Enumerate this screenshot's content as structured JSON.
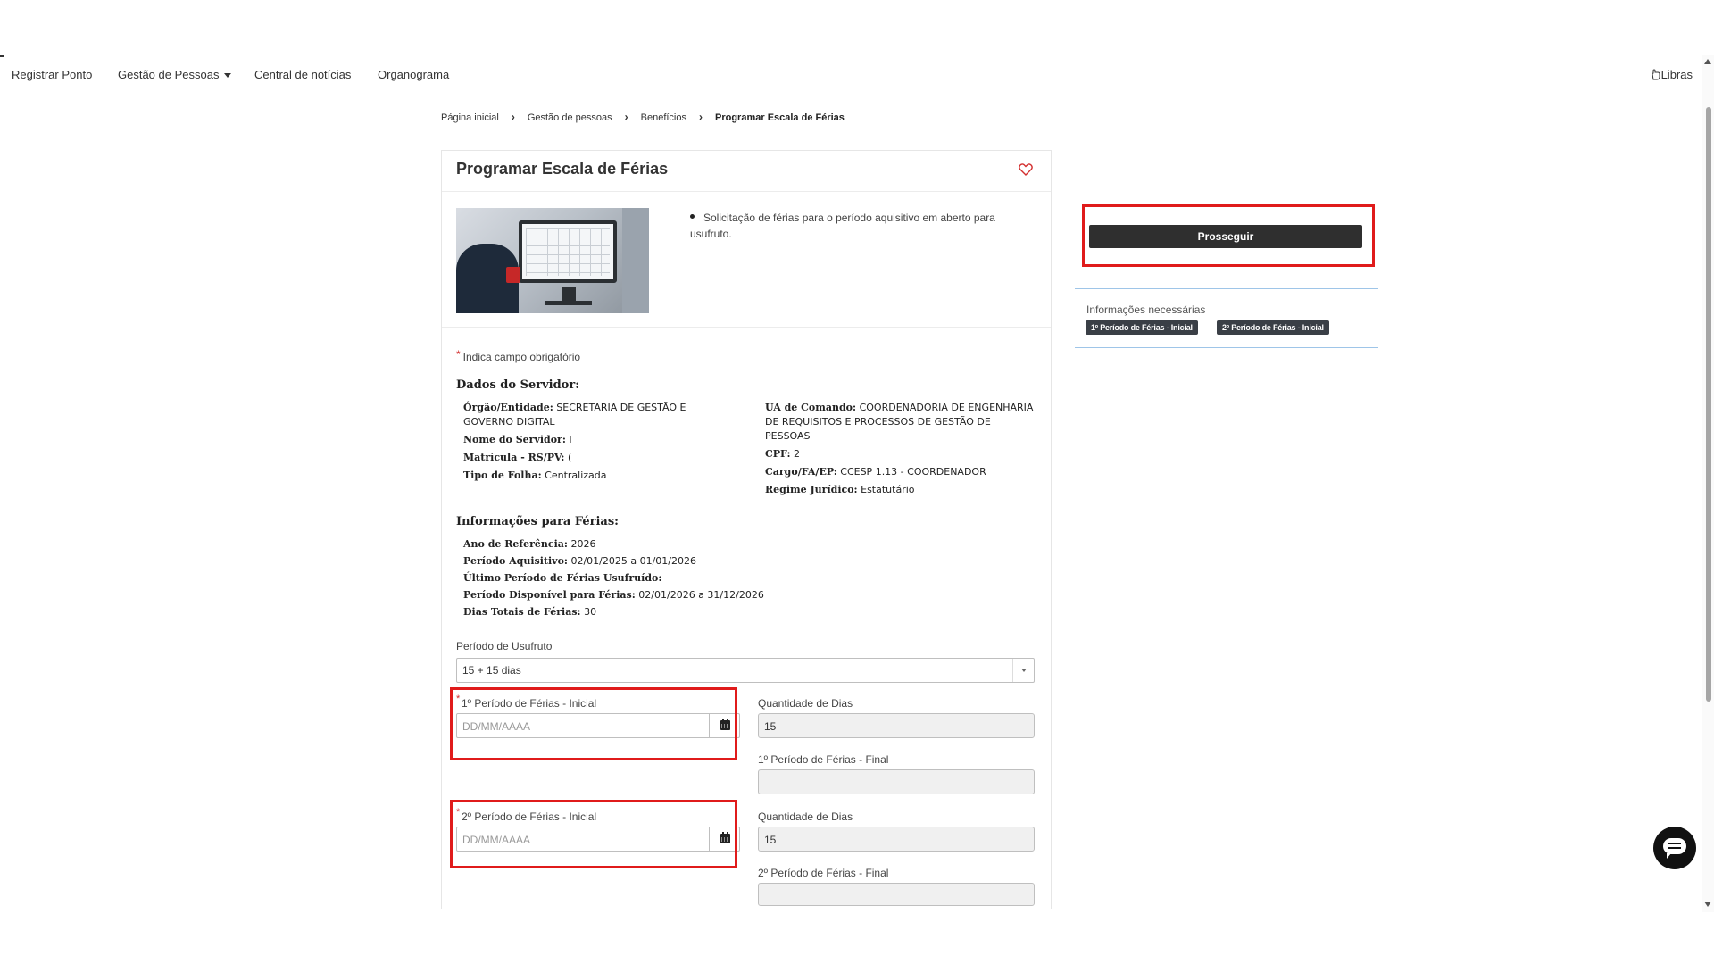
{
  "nav": {
    "items": [
      "Registrar Ponto",
      "Gestão de Pessoas",
      "Central de notícias",
      "Organograma"
    ],
    "libras": "Libras"
  },
  "breadcrumb": [
    "Página inicial",
    "Gestão de pessoas",
    "Benefícios",
    "Programar Escala de Férias"
  ],
  "card": {
    "title": "Programar Escala de Férias",
    "intro": "Solicitação de férias para o período aquisitivo em aberto para usufruto.",
    "required_note": "Indica campo obrigatório",
    "required_marker": "*"
  },
  "servidor": {
    "title": "Dados do Servidor:",
    "left": [
      {
        "label": "Órgão/Entidade:",
        "value": "SECRETARIA DE GESTÃO E GOVERNO DIGITAL"
      },
      {
        "label": "Nome do Servidor:",
        "value": "I"
      },
      {
        "label": "Matrícula - RS/PV:",
        "value": "("
      },
      {
        "label": "Tipo de Folha:",
        "value": "Centralizada"
      }
    ],
    "right": [
      {
        "label": "UA de Comando:",
        "value": "COORDENADORIA DE ENGENHARIA DE REQUISITOS E PROCESSOS DE GESTÃO DE PESSOAS"
      },
      {
        "label": "CPF:",
        "value": "2"
      },
      {
        "label": "Cargo/FA/EP:",
        "value": "CCESP 1.13 - COORDENADOR"
      },
      {
        "label": "Regime Jurídico:",
        "value": "Estatutário"
      }
    ]
  },
  "ferias": {
    "title": "Informações para Férias:",
    "items": [
      {
        "label": "Ano de Referência:",
        "value": "2026"
      },
      {
        "label": "Período Aquisitivo:",
        "value": "02/01/2025 a 01/01/2026"
      },
      {
        "label": "Último Período de Férias Usufruído:",
        "value": ""
      },
      {
        "label": "Período Disponível para Férias:",
        "value": "02/01/2026 a 31/12/2026"
      },
      {
        "label": "Dias Totais de Férias:",
        "value": "30"
      }
    ]
  },
  "form": {
    "periodo_label": "Período de Usufruto",
    "periodo_value": "15 + 15 dias",
    "p1_inicial_label": "1º Período de Férias - Inicial",
    "p1_inicial_placeholder": "DD/MM/AAAA",
    "p1_qtd_label": "Quantidade de Dias",
    "p1_qtd_value": "15",
    "p1_final_label": "1º Período de Férias - Final",
    "p1_final_value": "",
    "p2_inicial_label": "2º Período de Férias - Inicial",
    "p2_inicial_placeholder": "DD/MM/AAAA",
    "p2_qtd_label": "Quantidade de Dias",
    "p2_qtd_value": "15",
    "p2_final_label": "2º Período de Férias - Final",
    "p2_final_value": ""
  },
  "right_panel": {
    "button": "Prosseguir",
    "info_title": "Informações necessárias",
    "tags": [
      "1º Período de Férias - Inicial",
      "2º Período de Férias - Inicial"
    ]
  },
  "colors": {
    "highlight": "#e01b1b",
    "button_bg": "#2f2f2f",
    "divider": "#9ec5e8",
    "required": "#d32f2f"
  },
  "icons": [
    "hand-icon",
    "heart-icon",
    "calendar-icon",
    "chat-icon",
    "chevron-right-icon",
    "caret-down-icon"
  ]
}
